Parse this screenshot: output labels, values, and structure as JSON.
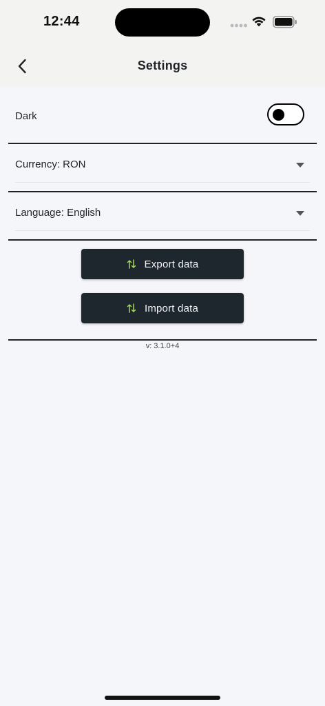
{
  "status_bar": {
    "time": "12:44"
  },
  "app_bar": {
    "title": "Settings",
    "back_icon": "chevron-left-icon"
  },
  "theme": {
    "label": "Dark",
    "toggle_on": false
  },
  "currency": {
    "label": "Currency: RON"
  },
  "language": {
    "label": "Language: English"
  },
  "actions": {
    "export_label": "Export data",
    "import_label": "Import data",
    "icon": "swap-vertical-icon",
    "icon_color": "#a8d65a"
  },
  "version": {
    "text": "v: 3.1.0+4"
  },
  "colors": {
    "button_bg": "#1e272e",
    "background": "#f5f6fa",
    "header_bg": "#f3f4f1"
  }
}
